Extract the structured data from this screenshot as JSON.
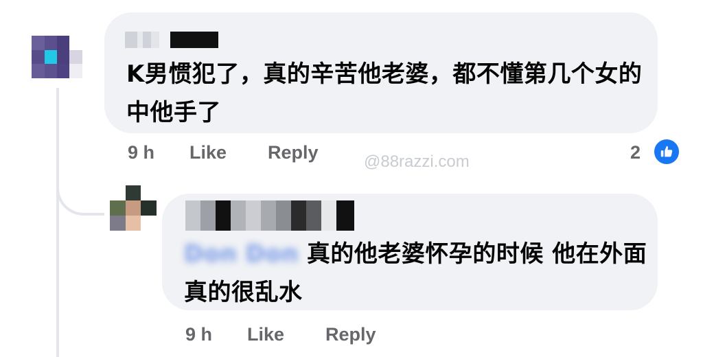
{
  "comments": [
    {
      "text": "K男惯犯了，真的辛苦他老婆，都不懂第几个女的中他手了",
      "time": "9 h",
      "like_label": "Like",
      "reply_label": "Reply",
      "reaction_count": "2",
      "reaction_icon": "thumbs-up-icon"
    },
    {
      "mention": "Don Don",
      "text": "真的他老婆怀孕的时候 他在外面真的很乱水",
      "time": "9 h",
      "like_label": "Like",
      "reply_label": "Reply"
    }
  ],
  "watermark": "@88razzi.com",
  "colors": {
    "bubble": "#f0f2f5",
    "meta_text": "#65676b",
    "like_badge": "#1877f2",
    "thread_line": "#e4e6eb"
  }
}
